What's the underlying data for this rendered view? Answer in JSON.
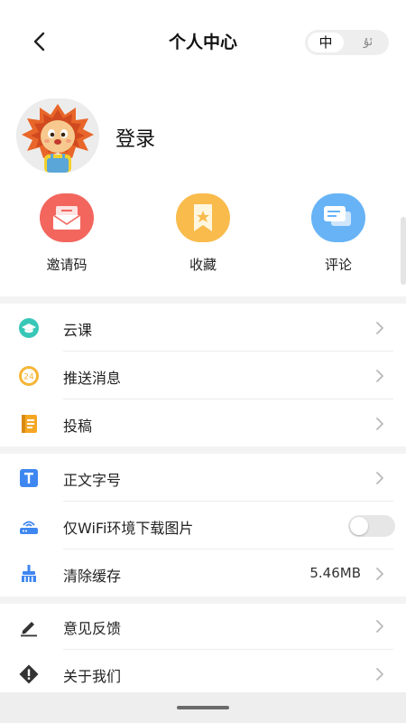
{
  "header": {
    "title": "个人中心",
    "back_icon": "chevron-left-icon",
    "lang_options": [
      "中",
      "ئۇ"
    ],
    "lang_selected": "中"
  },
  "profile": {
    "avatar_icon": "lion-mascot-avatar",
    "login_label": "登录"
  },
  "quick_actions": [
    {
      "label": "邀请码",
      "icon": "mail-invite-icon",
      "color": "#f2665e"
    },
    {
      "label": "收藏",
      "icon": "bookmark-icon",
      "color": "#f8bb4c"
    },
    {
      "label": "评论",
      "icon": "comment-icon",
      "color": "#67b3f6"
    }
  ],
  "menu": {
    "group1": [
      {
        "label": "云课",
        "icon": "graduation-cap-icon",
        "color": "#38c7b7"
      },
      {
        "label": "推送消息",
        "icon": "24h-clock-icon",
        "color": "#f5b535"
      },
      {
        "label": "投稿",
        "icon": "notebook-icon",
        "color": "#f5a623"
      }
    ],
    "group2": [
      {
        "label": "正文字号",
        "icon": "text-size-icon",
        "color": "#3f87f0"
      },
      {
        "label": "仅WiFi环境下载图片",
        "icon": "router-icon",
        "color": "#3f87f0",
        "toggle_on": false
      },
      {
        "label": "清除缓存",
        "icon": "broom-icon",
        "color": "#3f87f0",
        "value": "5.46MB"
      }
    ],
    "group3": [
      {
        "label": "意见反馈",
        "icon": "pencil-icon",
        "color": "#333333"
      },
      {
        "label": "关于我们",
        "icon": "info-diamond-icon",
        "color": "#333333"
      }
    ]
  },
  "colors": {
    "background": "#ffffff",
    "divider": "#f3f3f3",
    "chevron": "#b9b9b9"
  }
}
